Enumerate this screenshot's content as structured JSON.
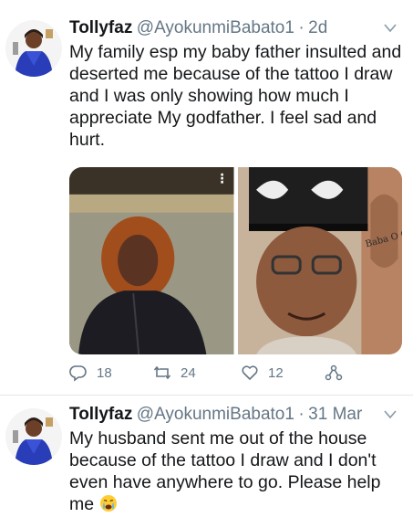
{
  "tweets": [
    {
      "name": "Tollyfaz",
      "handle": "@AyokunmiBabato1",
      "separator": "·",
      "date": "2d",
      "text": "My family esp my baby father insulted and deserted me because of the tattoo I draw and I was only showing how much I appreciate My godfather. I feel sad and hurt.",
      "actions": {
        "replies": "18",
        "retweets": "24",
        "likes": "12"
      }
    },
    {
      "name": "Tollyfaz",
      "handle": "@AyokunmiBabato1",
      "separator": "·",
      "date": "31 Mar",
      "text": "My husband sent me out of the house because of the tattoo I draw and I don't even have anywhere to go. Please help me",
      "emoji": "crying-face-emoji"
    }
  ],
  "media_menu": "⋮",
  "tattoo_text": "Baba O Oye",
  "icons": {
    "reply": "reply-icon",
    "retweet": "retweet-icon",
    "like": "heart-icon",
    "share": "share-icon",
    "caret": "chevron-down-icon"
  },
  "colors": {
    "text": "#14171a",
    "secondary": "#657786",
    "divider": "#e1e8ed"
  }
}
